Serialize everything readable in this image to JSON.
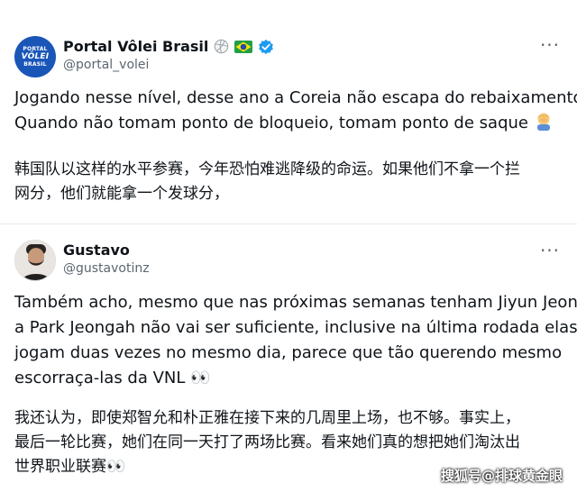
{
  "tweet1": {
    "avatar": {
      "logo_line1": "PORTAL",
      "logo_line2": "VÔLEI",
      "logo_line3": "BRASIL"
    },
    "display_name": "Portal Vôlei Brasil",
    "badges": [
      "volleyball-icon",
      "brazil-flag-icon",
      "verified-icon"
    ],
    "handle": "@portal_volei",
    "more_label": "···",
    "text_pt": [
      "Jogando nesse nível, desse ano a Coreia não escapa do rebaixamento.",
      "Quando não tomam ponto de bloqueio, tomam ponto de saque"
    ],
    "text_zh": [
      "韩国队以这样的水平参赛，今年恐怕难逃降级的命运。如果他们不拿一个拦",
      "网分，他们就能拿一个发球分，"
    ]
  },
  "tweet2": {
    "display_name": "Gustavo",
    "handle": "@gustavotinz",
    "more_label": "···",
    "text_pt": [
      "Também acho, mesmo que nas próximas semanas tenham Jiyun Jeong e",
      "a Park Jeongah não vai ser suficiente, inclusive na última rodada elas",
      "jogam duas vezes no mesmo dia, parece que tão querendo mesmo",
      "escorraça-las da VNL 👀"
    ],
    "text_zh": [
      "我还认为，即使郑智允和朴正雅在接下来的几周里上场，也不够。事实上，",
      "最后一轮比赛，她们在同一天打了两场比赛。看来她们真的想把她们淘汰出",
      "世界职业联赛👀"
    ]
  },
  "watermark": "搜狐号@排球黄金眼",
  "colors": {
    "verified": "#1d9bf0",
    "logo_bg": "#1a56b8",
    "muted": "#5b6670"
  }
}
